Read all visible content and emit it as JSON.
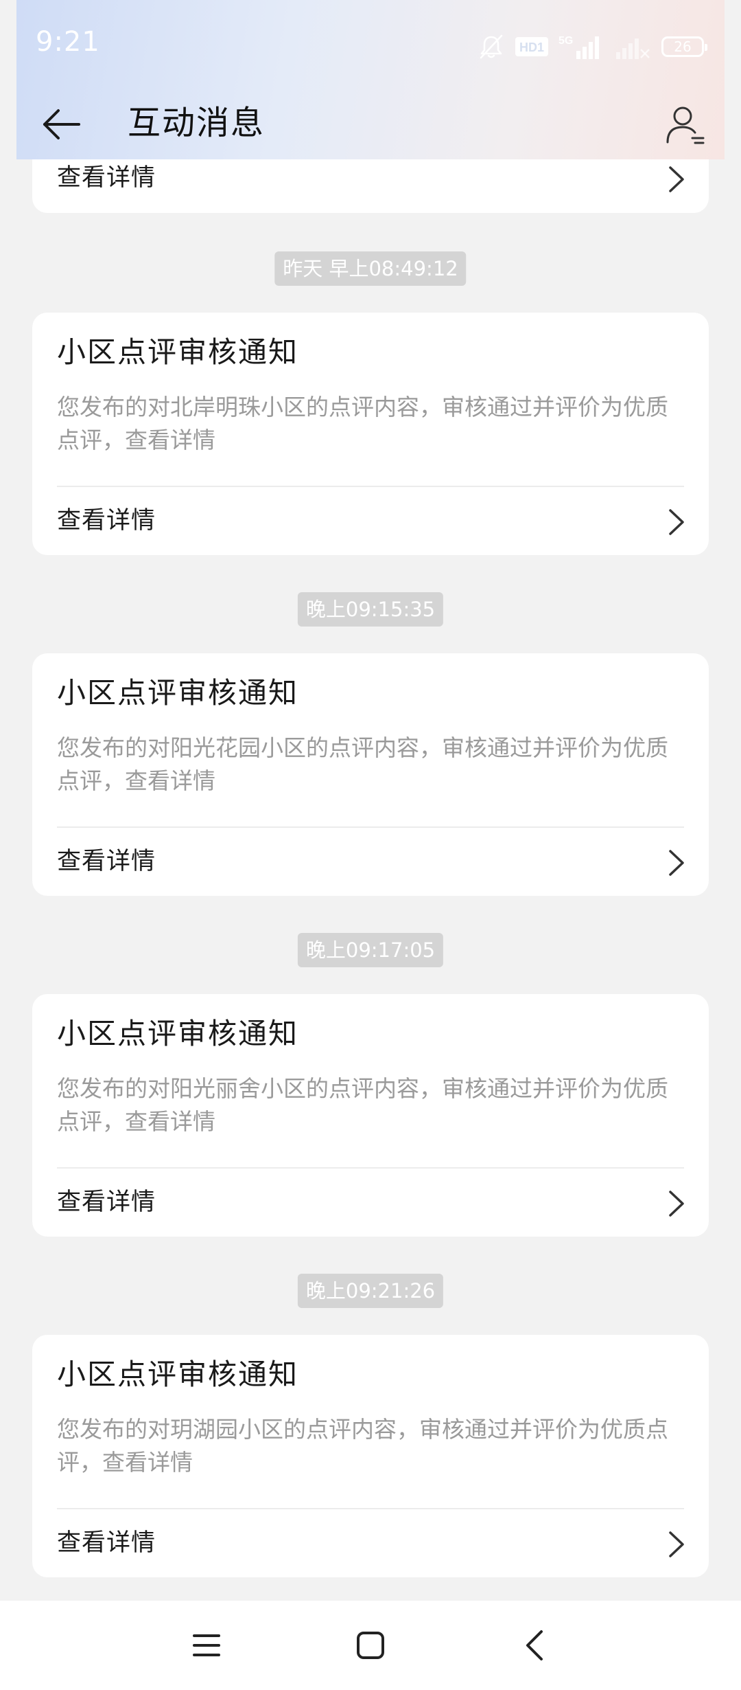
{
  "status_bar": {
    "time": "9:21",
    "network_badge": "HD1",
    "network_type": "5G",
    "battery_level": "26"
  },
  "header": {
    "title": "互动消息"
  },
  "partial_card": {
    "detail_label": "查看详情"
  },
  "messages": [
    {
      "timestamp": "昨天 早上08:49:12",
      "title": "小区点评审核通知",
      "body": "您发布的对北岸明珠小区的点评内容，审核通过并评价为优质点评，查看详情",
      "detail_label": "查看详情"
    },
    {
      "timestamp": "晚上09:15:35",
      "title": "小区点评审核通知",
      "body": "您发布的对阳光花园小区的点评内容，审核通过并评价为优质点评，查看详情",
      "detail_label": "查看详情"
    },
    {
      "timestamp": "晚上09:17:05",
      "title": "小区点评审核通知",
      "body": "您发布的对阳光丽舍小区的点评内容，审核通过并评价为优质点评，查看详情",
      "detail_label": "查看详情"
    },
    {
      "timestamp": "晚上09:21:26",
      "title": "小区点评审核通知",
      "body": "您发布的对玥湖园小区的点评内容，审核通过并评价为优质点评，查看详情",
      "detail_label": "查看详情"
    }
  ],
  "icons": {
    "back": "arrow-left-icon",
    "profile": "user-icon",
    "chevron": "chevron-right-icon",
    "menu": "menu-icon",
    "home": "square-home-icon",
    "nav_back": "chevron-left-icon",
    "mute": "bell-off-icon",
    "signal": "signal-icon",
    "wifi": "wifi-icon",
    "battery": "battery-icon"
  },
  "colors": {
    "background": "#f2f2f2",
    "card": "#ffffff",
    "timestamp_pill": "#d4d4d4",
    "body_text": "#9a9a9a",
    "title_text": "#1a1a1a"
  }
}
